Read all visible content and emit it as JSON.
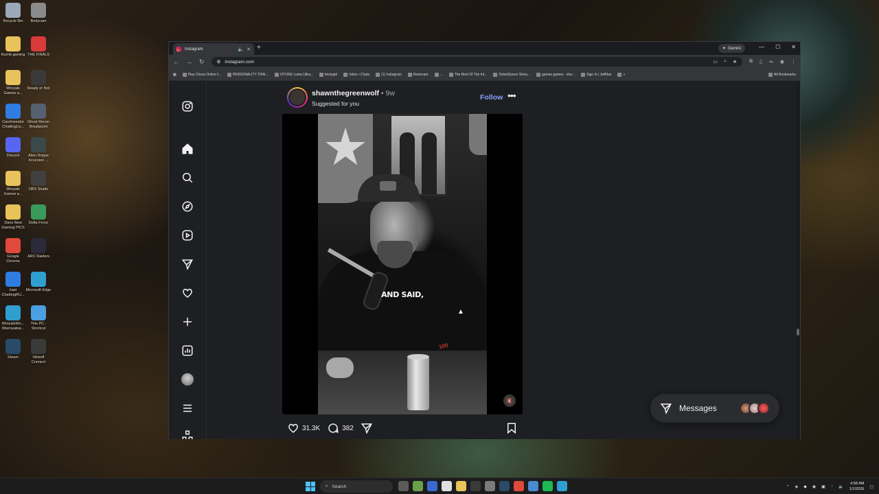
{
  "desktop": {
    "icons": [
      {
        "label": "Recycle Bin",
        "color": "#9aa8b8"
      },
      {
        "label": "Bodycam",
        "color": "#8a8a8a"
      },
      {
        "label": "thumb gaming",
        "color": "#e8c25a"
      },
      {
        "label": "THE FINALS",
        "color": "#d93a3a"
      },
      {
        "label": "Wroyals Games a...",
        "color": "#e8c25a"
      },
      {
        "label": "Ready or Not",
        "color": "#3a3a3a"
      },
      {
        "label": "CaroInvestor ChattingLiv...",
        "color": "#2f7de0"
      },
      {
        "label": "Ghost Recon Breakpoint",
        "color": "#556070"
      },
      {
        "label": "Discord",
        "color": "#5865f2"
      },
      {
        "label": "Alien Rogue Incursion ...",
        "color": "#3a4a4a"
      },
      {
        "label": "Wroyals Games a...",
        "color": "#e8c25a"
      },
      {
        "label": "OBS Studio",
        "color": "#404040"
      },
      {
        "label": "Dans New Gaming PICS",
        "color": "#e8c25a"
      },
      {
        "label": "Delta Force",
        "color": "#3a9a5a"
      },
      {
        "label": "Google Chrome",
        "color": "#e04a3a"
      },
      {
        "label": "ARC Raiders",
        "color": "#2a2a3a"
      },
      {
        "label": "kast ChattingRU...",
        "color": "#2f7de0"
      },
      {
        "label": "Microsoft Edge",
        "color": "#2f9fd0"
      },
      {
        "label": "WroyalsWo... Wwroyalsw...",
        "color": "#2f9fd0"
      },
      {
        "label": "This PC - Shortcut",
        "color": "#4aa0e0"
      },
      {
        "label": "Steam",
        "color": "#2a4a6a"
      },
      {
        "label": "Ubisoft Connect",
        "color": "#3a3a3a"
      }
    ]
  },
  "browser": {
    "tab_title": "Instagram",
    "new_tab_symbol": "+",
    "gemini_label": "Gemini",
    "url": "instagram.com",
    "bookmarks": [
      "Play Chess Online f...",
      "PERSONALITY TRAI...",
      "VITURE Luma Ultra...",
      "feistygirl",
      "Inbox • Chats",
      "(1) Instagram",
      "Restream",
      "...",
      "The Best Of The Int...",
      "DeleriQueen Strea...",
      "games games - sha...",
      "Sign In | JetBlue",
      "»"
    ],
    "all_bookmarks": "All Bookmarks"
  },
  "post": {
    "username": "shawnthegreenwolf",
    "time": " • 9w",
    "suggested": "Suggested for you",
    "follow": "Follow",
    "more": "•••",
    "subtitle": "AND SAID,",
    "likes": "31.3K",
    "comments": "382"
  },
  "messages": {
    "label": "Messages"
  },
  "taskbar": {
    "search_placeholder": "Search",
    "time": "4:58 AM",
    "date": "1/1/2026"
  },
  "colors": {
    "accent_follow": "#8c9fff",
    "page_bg": "#1e1f22"
  }
}
